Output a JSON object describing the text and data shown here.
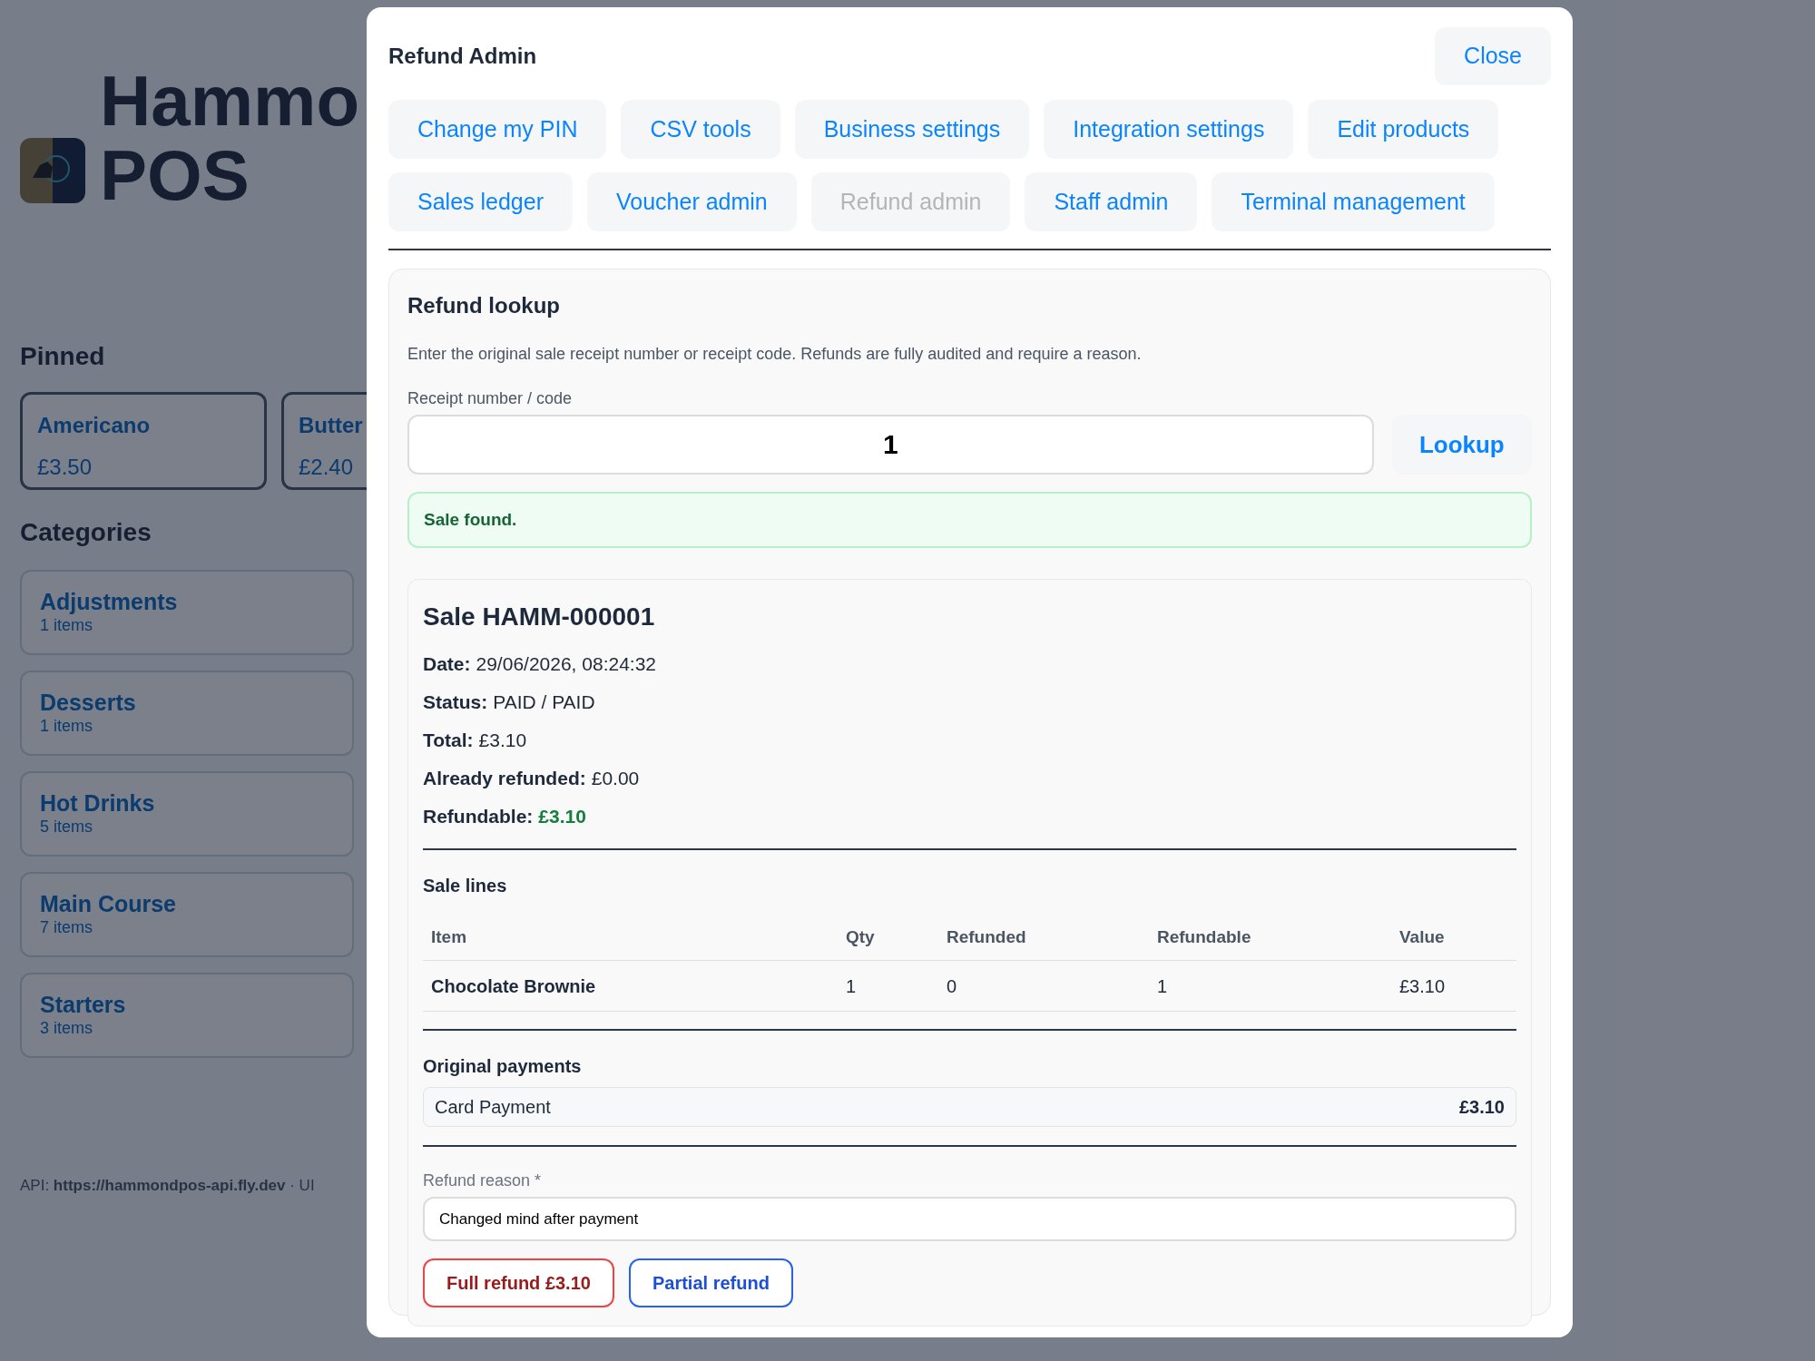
{
  "background": {
    "title_lines": [
      "Hammo",
      "POS"
    ],
    "pinned": {
      "heading": "Pinned",
      "items": [
        {
          "name": "Americano",
          "price": "£3.50"
        },
        {
          "name": "Butter",
          "price": "£2.40"
        }
      ]
    },
    "categories": {
      "heading": "Categories",
      "items": [
        {
          "name": "Adjustments",
          "count": "1 items"
        },
        {
          "name": "Desserts",
          "count": "1 items"
        },
        {
          "name": "Hot Drinks",
          "count": "5 items"
        },
        {
          "name": "Main Course",
          "count": "7 items"
        },
        {
          "name": "Starters",
          "count": "3 items"
        }
      ]
    },
    "footer": "API: **https://hammondpos-api.fly.dev** · UI"
  },
  "modal": {
    "title": "Refund Admin",
    "close": "Close",
    "tabs": [
      {
        "label": "Change my PIN",
        "selected": false
      },
      {
        "label": "CSV tools",
        "selected": false
      },
      {
        "label": "Business settings",
        "selected": false
      },
      {
        "label": "Integration settings",
        "selected": false
      },
      {
        "label": "Edit products",
        "selected": false
      },
      {
        "label": "Sales ledger",
        "selected": false
      },
      {
        "label": "Voucher admin",
        "selected": false
      },
      {
        "label": "Refund admin",
        "selected": true
      },
      {
        "label": "Staff admin",
        "selected": false
      },
      {
        "label": "Terminal management",
        "selected": false
      }
    ],
    "lookup": {
      "heading": "Refund lookup",
      "description": "Enter the original sale receipt number or receipt code. Refunds are fully audited and require a reason.",
      "field_label": "Receipt number / code",
      "value": "1",
      "button": "Lookup",
      "alert": "Sale found."
    },
    "sale": {
      "title": "Sale HAMM-000001",
      "facts": [
        {
          "label": "Date:",
          "value": "29/06/2026, 08:24:32",
          "kind": "plain"
        },
        {
          "label": "Status:",
          "value": "PAID / PAID",
          "kind": "plain"
        },
        {
          "label": "Total:",
          "value": "£3.10",
          "kind": "plain"
        },
        {
          "label": "Already refunded:",
          "value": "£0.00",
          "kind": "plain"
        },
        {
          "label": "Refundable:",
          "value": "£3.10",
          "kind": "highlight"
        }
      ],
      "lines": {
        "heading": "Sale lines",
        "columns": [
          "Item",
          "Qty",
          "Refunded",
          "Refundable",
          "Value"
        ],
        "rows": [
          [
            "Chocolate Brownie",
            "1",
            "0",
            "1",
            "£3.10"
          ]
        ]
      },
      "payments": {
        "heading": "Original payments",
        "items": [
          {
            "method": "Card Payment",
            "amount": "£3.10"
          }
        ]
      },
      "reason": {
        "label": "Refund reason *",
        "value": "Changed mind after payment"
      },
      "actions": [
        {
          "label": "Full refund £3.10",
          "kind": "danger"
        },
        {
          "label": "Partial refund",
          "kind": "primary"
        }
      ]
    }
  }
}
